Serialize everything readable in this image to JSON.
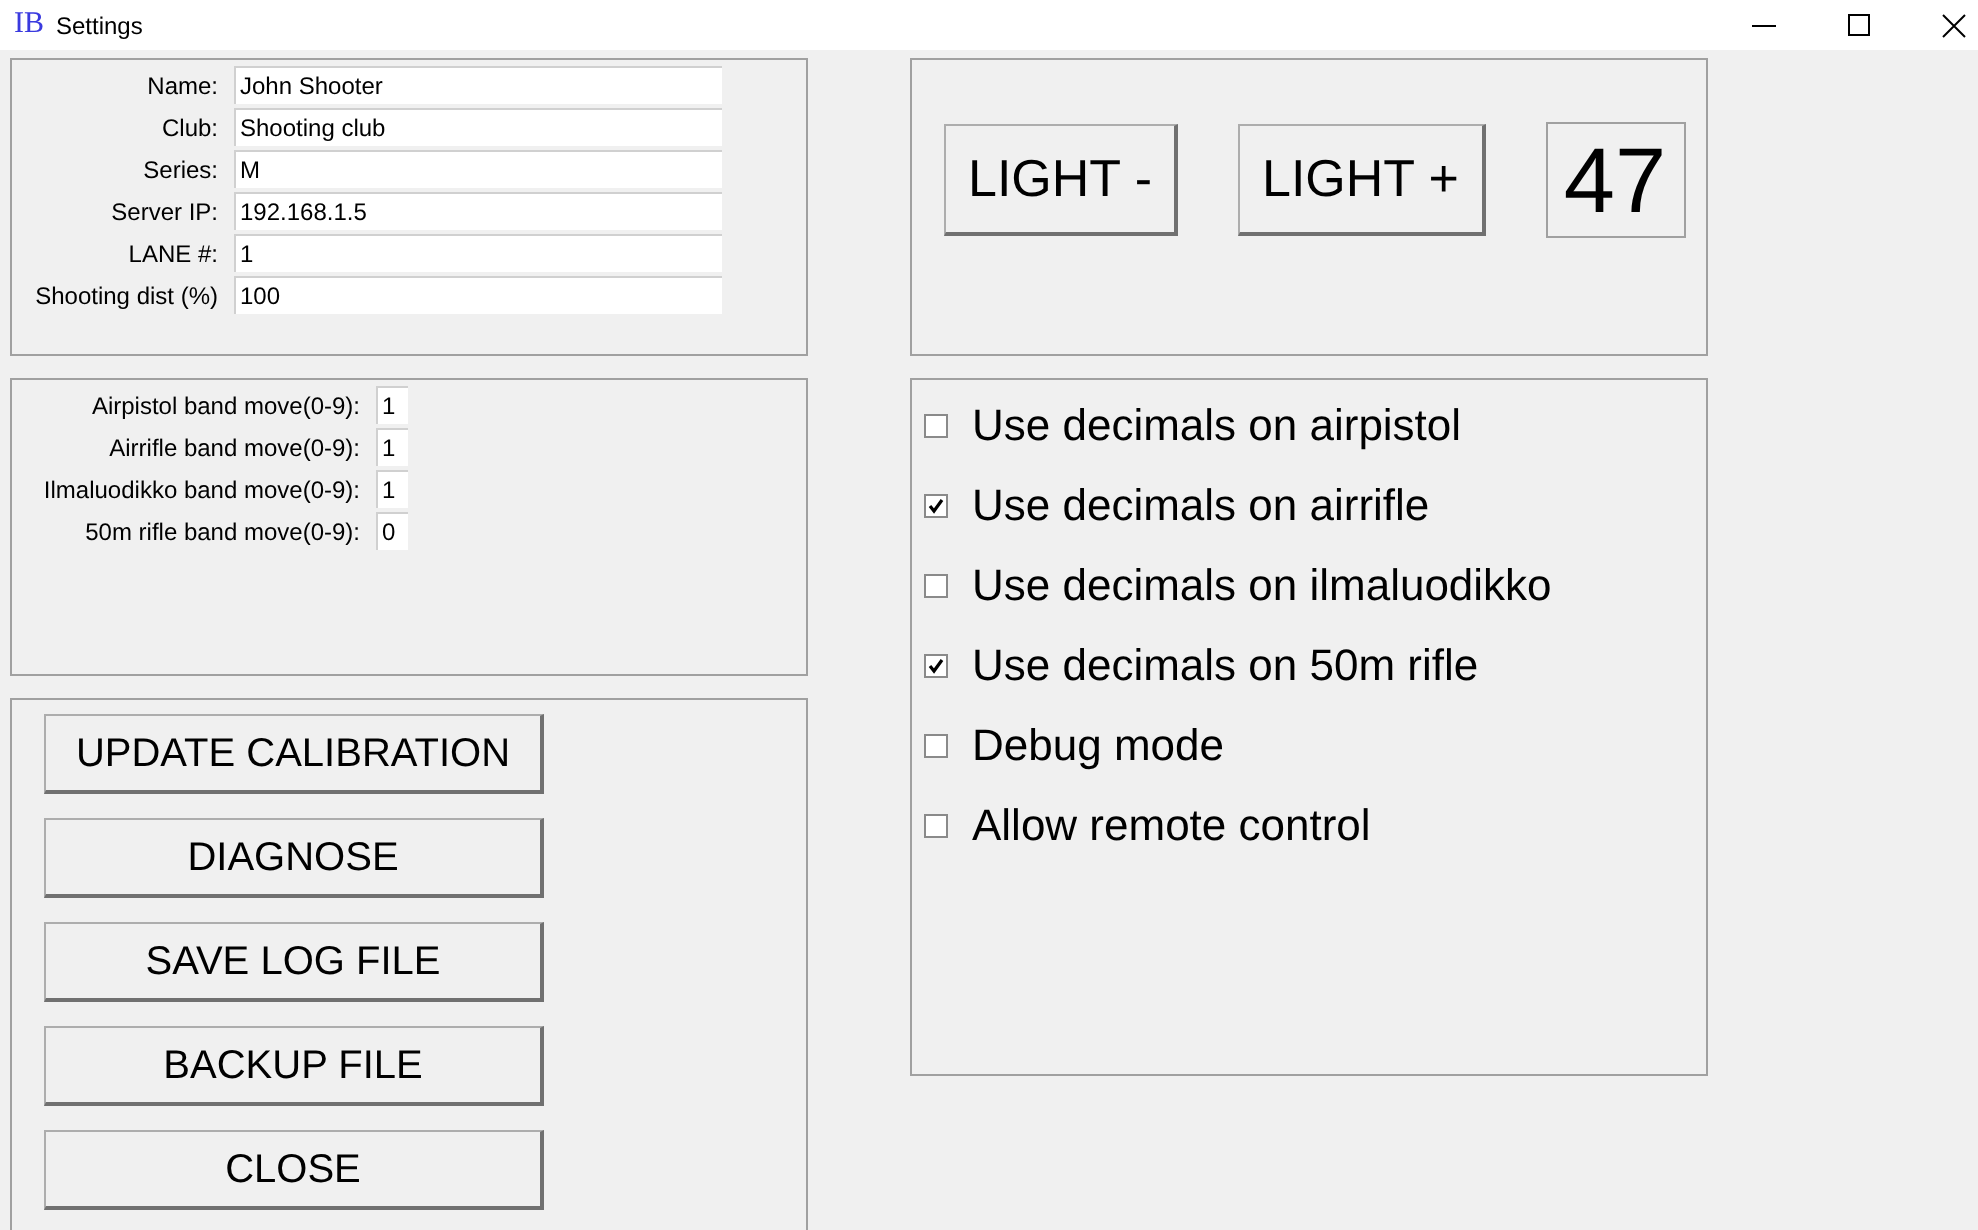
{
  "window": {
    "icon_text": "IB",
    "title": "Settings"
  },
  "fields": [
    {
      "label": "Name:",
      "value": "John Shooter"
    },
    {
      "label": "Club:",
      "value": "Shooting club"
    },
    {
      "label": "Series:",
      "value": "M"
    },
    {
      "label": "Server IP:",
      "value": "192.168.1.5"
    },
    {
      "label": "LANE #:",
      "value": "1"
    },
    {
      "label": "Shooting dist (%)",
      "value": "100"
    }
  ],
  "band_moves": [
    {
      "label": "Airpistol band move(0-9):",
      "value": "1"
    },
    {
      "label": "Airrifle band move(0-9):",
      "value": "1"
    },
    {
      "label": "Ilmaluodikko band move(0-9):",
      "value": "1"
    },
    {
      "label": "50m rifle band move(0-9):",
      "value": "0"
    }
  ],
  "buttons": [
    "UPDATE CALIBRATION",
    "DIAGNOSE",
    "SAVE LOG FILE",
    "BACKUP FILE",
    "CLOSE"
  ],
  "light": {
    "buttons": [
      "LIGHT -",
      "LIGHT +"
    ],
    "value": "47"
  },
  "options": [
    {
      "label": "Use decimals on airpistol",
      "checked": false
    },
    {
      "label": "Use decimals on airrifle",
      "checked": true
    },
    {
      "label": "Use decimals on ilmaluodikko",
      "checked": false
    },
    {
      "label": "Use decimals on 50m rifle",
      "checked": true
    },
    {
      "label": "Debug mode",
      "checked": false
    },
    {
      "label": "Allow remote control",
      "checked": false
    }
  ]
}
